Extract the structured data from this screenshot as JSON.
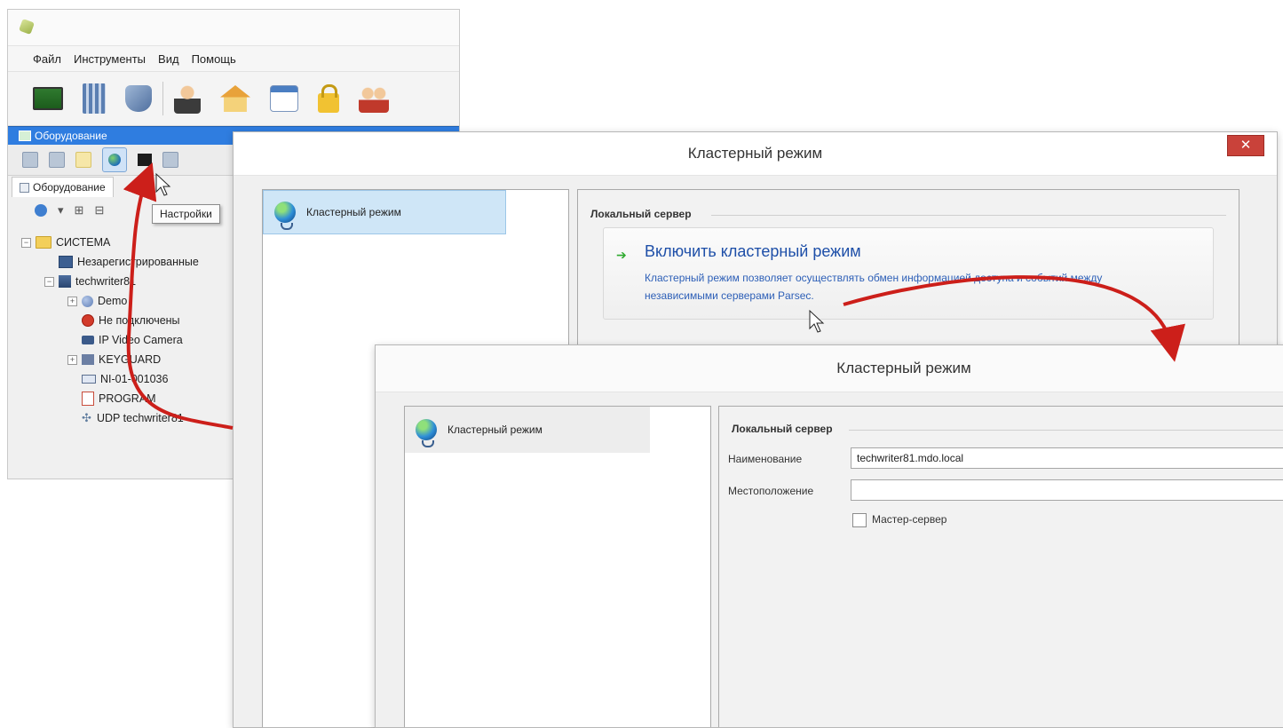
{
  "app": {
    "menu": [
      "Файл",
      "Инструменты",
      "Вид",
      "Помощь"
    ],
    "toolbar_icons": [
      "equipment-board-icon",
      "building-icon",
      "shield-icon",
      "user-icon",
      "house-icon",
      "calendar-icon",
      "lock-icon",
      "users-icon"
    ],
    "panel_title": "Оборудование",
    "tab_label": "Оборудование",
    "tooltip": "Настройки",
    "tree": [
      {
        "label": "СИСТЕМА",
        "icon": "folder-icon",
        "expander": "−",
        "level": 0
      },
      {
        "label": "Незарегистрированные",
        "icon": "pc-icon",
        "expander": "",
        "level": 1
      },
      {
        "label": "techwriter81",
        "icon": "server-icon",
        "expander": "−",
        "level": 1
      },
      {
        "label": "Demo",
        "icon": "globe-icon",
        "expander": "+",
        "level": 2
      },
      {
        "label": "Не подключены",
        "icon": "stop-icon",
        "expander": "",
        "level": 2
      },
      {
        "label": "IP Video Camera",
        "icon": "camera-icon",
        "expander": "",
        "level": 2
      },
      {
        "label": "KEYGUARD",
        "icon": "keyguard-icon",
        "expander": "+",
        "level": 2
      },
      {
        "label": "NI-01-001036",
        "icon": "ni-icon",
        "expander": "",
        "level": 2
      },
      {
        "label": "PROGRAM",
        "icon": "program-icon",
        "expander": "",
        "level": 2
      },
      {
        "label": "UDP techwriter81",
        "icon": "udp-icon",
        "expander": "",
        "level": 2
      }
    ]
  },
  "dialog1": {
    "title": "Кластерный режим",
    "close": "✕",
    "nav_item": "Кластерный режим",
    "group_title": "Локальный сервер",
    "command_title": "Включить кластерный режим",
    "command_desc": "Кластерный режим позволяет осуществлять обмен информацией доступа и событий между независимыми серверами Parsec."
  },
  "dialog2": {
    "title": "Кластерный режим",
    "nav_item": "Кластерный режим",
    "group_title": "Локальный сервер",
    "name_label": "Наименование",
    "name_value": "techwriter81.mdo.local",
    "location_label": "Местоположение",
    "location_value": "",
    "master_label": "Мастер-сервер",
    "master_checked": false
  },
  "colors": {
    "arrow": "#cc1f1a",
    "panel_header": "#2f7de0",
    "link": "#1e4fa8",
    "close": "#c9423a"
  }
}
